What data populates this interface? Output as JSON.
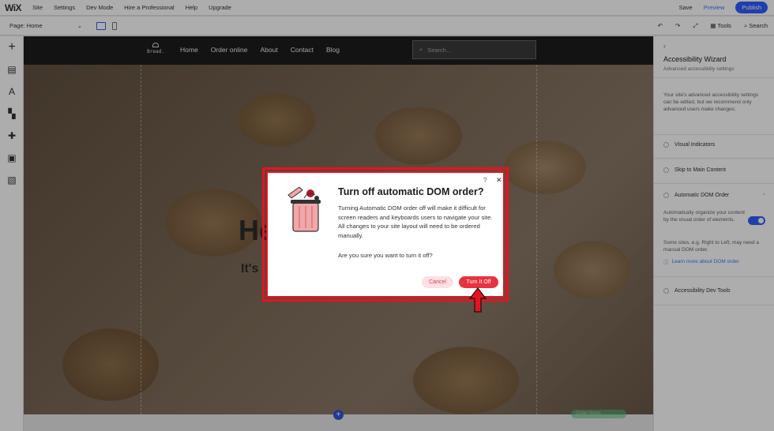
{
  "editor": {
    "logo": "WiX",
    "menu": [
      "Site",
      "Settings",
      "Dev Mode",
      "Hire a Professional",
      "Help",
      "Upgrade"
    ],
    "save": "Save",
    "preview": "Preview",
    "publish": "Publish",
    "page_label": "Page: Home",
    "tools": "Tools",
    "search": "Search"
  },
  "site": {
    "logo_text": "Bread.",
    "nav": [
      "Home",
      "Order online",
      "About",
      "Contact",
      "Blog"
    ],
    "search_placeholder": "Search...",
    "hero_title": "He",
    "hero_subtitle": "It's"
  },
  "panel": {
    "back": "‹",
    "title": "Accessibility Wizard",
    "subtitle": "Advanced accessibility settings",
    "description": "Your site's advanced accessibility settings can be edited, but we recommend only advanced users make changes.",
    "items": [
      "Visual Indicators",
      "Skip to Main Content",
      "Automatic DOM Order",
      "Accessibility Dev Tools"
    ],
    "dom_desc": "Automatically organize your content by the visual order of elements.",
    "dom_note": "Some sites, e.g. Right to Left, may need a manual DOM order.",
    "dom_link": "Learn more about DOM order",
    "strip_label": "Order Items"
  },
  "modal": {
    "help": "?",
    "close": "✕",
    "title": "Turn off automatic DOM order?",
    "body": "Turning Automatic DOM order off will make it difficult for screen readers and keyboards users to navigate your site. All changes to your site layout will need to be ordered manually.",
    "question": "Are you sure you want to turn it off?",
    "cancel": "Cancel",
    "confirm": "Turn It Off"
  },
  "colors": {
    "accent": "#2f5dff",
    "highlight": "#e8121f",
    "confirm": "#e8323f"
  }
}
